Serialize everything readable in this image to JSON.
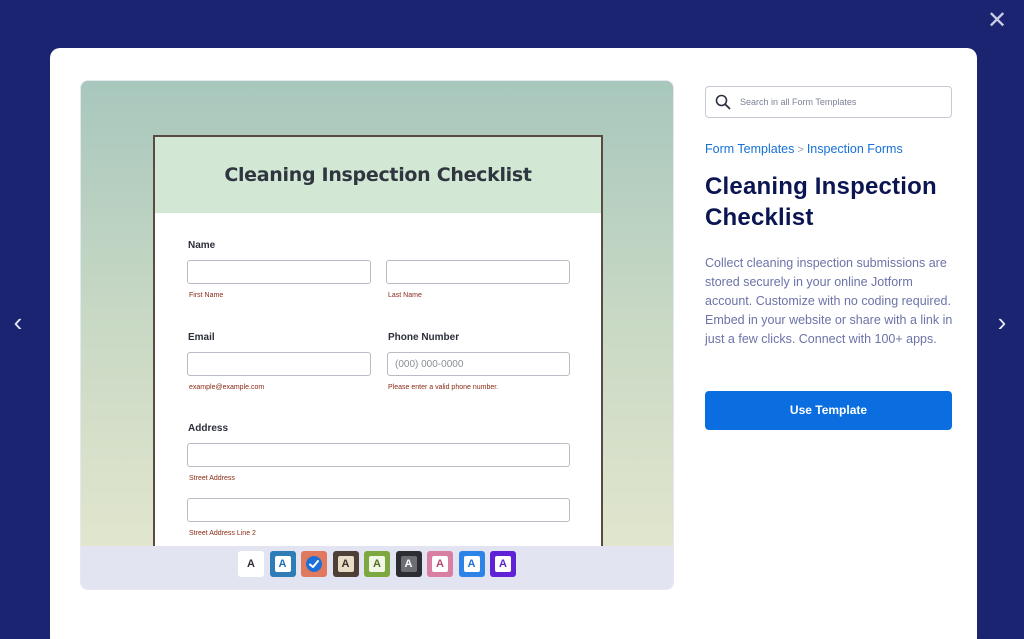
{
  "navigation": {
    "close_symbol": "✕",
    "prev_symbol": "‹",
    "next_symbol": "›"
  },
  "preview": {
    "form_title": "Cleaning Inspection Checklist",
    "fields": {
      "name_label": "Name",
      "first_name_sub": "First Name",
      "last_name_sub": "Last Name",
      "email_label": "Email",
      "email_sub": "example@example.com",
      "phone_label": "Phone Number",
      "phone_placeholder": "(000) 000-0000",
      "phone_sub": "Please enter a valid phone number.",
      "address_label": "Address",
      "street_sub": "Street Address",
      "street2_sub": "Street Address Line 2"
    },
    "theme_swatches": [
      {
        "letter": "A",
        "bg": "#ffffff",
        "fg": "#2b2f3a",
        "frame": "#ffffff",
        "icon": "letter"
      },
      {
        "letter": "A",
        "bg": "#ffffff",
        "fg": "#1f6fb5",
        "frame": "#2f7db6",
        "icon": "letter"
      },
      {
        "letter": "",
        "bg": "#1f6fd6",
        "fg": "#ffffff",
        "frame": "#e07a5f",
        "icon": "check-icon"
      },
      {
        "letter": "A",
        "bg": "#e9ddc7",
        "fg": "#3a2f29",
        "frame": "#4e3f37",
        "icon": "letter"
      },
      {
        "letter": "A",
        "bg": "#f2f6e6",
        "fg": "#4d6f21",
        "frame": "#7ca83f",
        "icon": "letter"
      },
      {
        "letter": "A",
        "bg": "#6b6e75",
        "fg": "#ffffff",
        "frame": "#2b2d33",
        "icon": "letter"
      },
      {
        "letter": "A",
        "bg": "#ffffff",
        "fg": "#b04a73",
        "frame": "#d97fa3",
        "icon": "letter"
      },
      {
        "letter": "A",
        "bg": "#ffffff",
        "fg": "#1f6fd6",
        "frame": "#2d83e6",
        "icon": "letter"
      },
      {
        "letter": "A",
        "bg": "#ffffff",
        "fg": "#5a23c8",
        "frame": "#5f22d6",
        "icon": "letter"
      }
    ]
  },
  "sidebar": {
    "search_placeholder": "Search in all Form Templates",
    "breadcrumb": {
      "root": "Form Templates",
      "separator": ">",
      "category": "Inspection Forms"
    },
    "title": "Cleaning Inspection Checklist",
    "description": "Collect cleaning inspection submissions are stored securely in your online Jotform account. Customize with no coding required. Embed in your website or share with a link in just a few clicks. Connect with 100+ apps.",
    "use_button": "Use Template"
  },
  "colors": {
    "overlay": "#1b2470",
    "accent": "#0b6ee0",
    "title": "#0a1551",
    "link": "#1571d8"
  }
}
